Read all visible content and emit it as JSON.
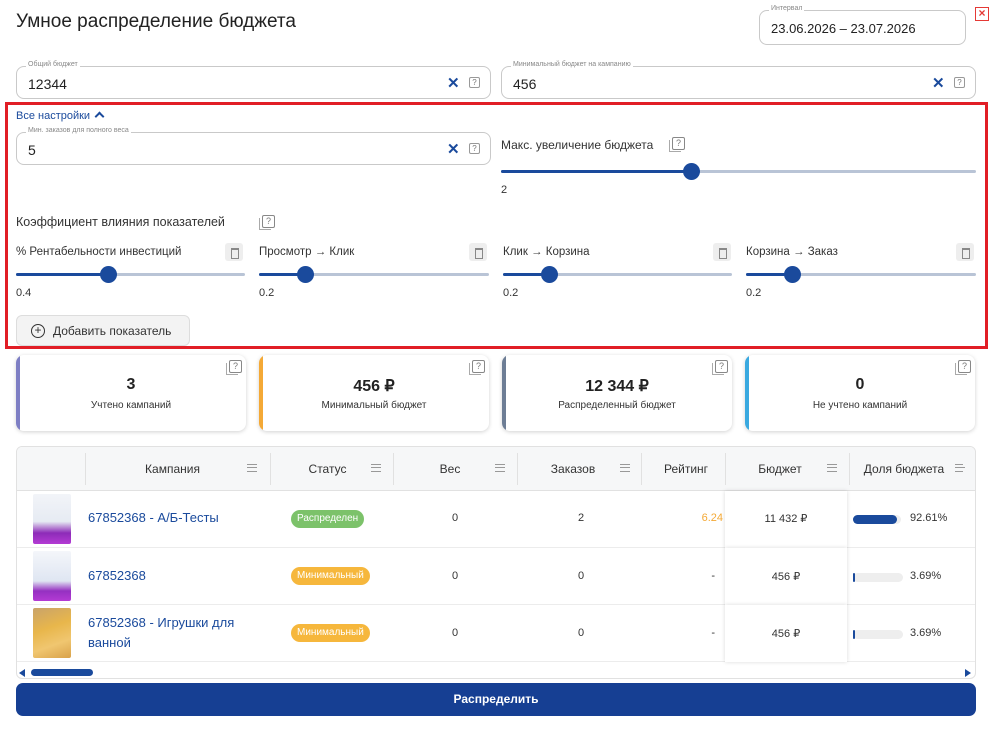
{
  "title": "Умное распределение бюджета",
  "interval": {
    "label": "Интервал",
    "value": "23.06.2026 – 23.07.2026"
  },
  "total_budget": {
    "label": "Общий бюджет",
    "value": "12344",
    "clear": "✕",
    "help": "?"
  },
  "min_budget": {
    "label": "Минимальный бюджет на кампанию",
    "value": "456",
    "clear": "✕",
    "help": "?"
  },
  "settings_link": "Все настройки",
  "min_orders": {
    "label": "Мин. заказов для полного веса",
    "value": "5",
    "clear": "✕",
    "help": "?"
  },
  "max_increase": {
    "label": "Макс. увеличение бюджета",
    "value": "2",
    "fraction": 0.4
  },
  "coef_title": "Коэффициент влияния показателей",
  "metrics": [
    {
      "label": "% Рентабельности инвестиций",
      "value": "0.4",
      "fraction": 0.4
    },
    {
      "label": "Просмотр → Клик",
      "value": "0.2",
      "fraction": 0.2
    },
    {
      "label": "Клик → Корзина",
      "value": "0.2",
      "fraction": 0.2
    },
    {
      "label": "Корзина → Заказ",
      "value": "0.2",
      "fraction": 0.2
    }
  ],
  "add_metric_label": "Добавить показатель",
  "summary_cards": [
    {
      "value": "3",
      "label": "Учтено кампаний",
      "color": "#7e7fc4"
    },
    {
      "value": "456 ₽",
      "label": "Минимальный бюджет",
      "color": "#f4a936"
    },
    {
      "value": "12 344 ₽",
      "label": "Распределенный бюджет",
      "color": "#6d7d95"
    },
    {
      "value": "0",
      "label": "Не учтено кампаний",
      "color": "#3aa9e0"
    }
  ],
  "table": {
    "headers": [
      "Кампания",
      "Статус",
      "Вес",
      "Заказов",
      "Рейтинг",
      "Бюджет",
      "Доля бюджета"
    ],
    "rows": [
      {
        "campaign": "67852368 - А/Б-Тесты",
        "status": "Распределен",
        "status_color": "#7cc26a",
        "weight": "0",
        "orders": "2",
        "rating": "6.24",
        "budget": "11 432 ₽",
        "share": "92.61%",
        "share_value": 0.9261
      },
      {
        "campaign": "67852368",
        "status": "Минимальный",
        "status_color": "#f6b73c",
        "weight": "0",
        "orders": "0",
        "rating": "-",
        "budget": "456 ₽",
        "share": "3.69%",
        "share_value": 0.0369
      },
      {
        "campaign": "67852368 - Игрушки для ванной",
        "status": "Минимальный",
        "status_color": "#f6b73c",
        "weight": "0",
        "orders": "0",
        "rating": "-",
        "budget": "456 ₽",
        "share": "3.69%",
        "share_value": 0.0369
      }
    ]
  },
  "submit_label": "Распределить",
  "colors": {
    "primary": "#1a4a9c",
    "highlight": "#e11e26",
    "rating": "#f4a936"
  },
  "icons": [
    "close-icon",
    "clear-icon",
    "help-icon",
    "chevron-up-icon",
    "trash-icon",
    "plus-circle-icon",
    "menu-icon",
    "sort-icon"
  ]
}
